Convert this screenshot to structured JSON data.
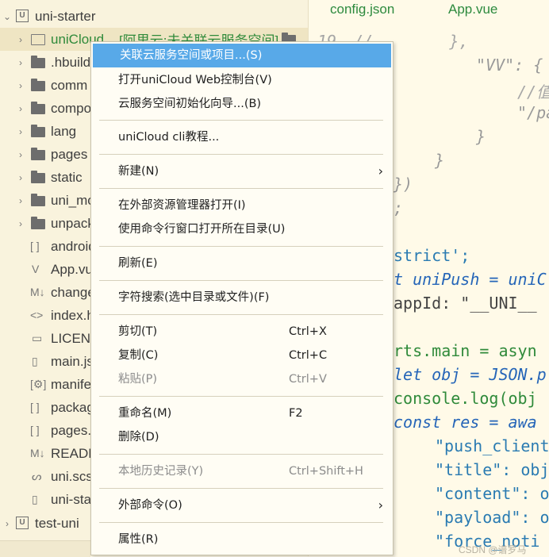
{
  "sidebar": {
    "project_root": "uni-starter",
    "items": [
      {
        "label": "uniCloud",
        "suffix": "[阿里云:未关联云服务空间]",
        "icon": "folder-open-icon"
      },
      {
        "label": ".hbuild",
        "icon": "folder-icon"
      },
      {
        "label": "comm",
        "icon": "folder-icon"
      },
      {
        "label": "compo",
        "icon": "folder-icon"
      },
      {
        "label": "lang",
        "icon": "folder-icon"
      },
      {
        "label": "pages",
        "icon": "folder-icon"
      },
      {
        "label": "static",
        "icon": "folder-icon"
      },
      {
        "label": "uni_mo",
        "icon": "folder-icon"
      },
      {
        "label": "unpack",
        "icon": "folder-icon"
      },
      {
        "label": "android",
        "icon": "json-icon"
      },
      {
        "label": "App.vu",
        "icon": "vue-icon"
      },
      {
        "label": "change",
        "icon": "markdown-icon"
      },
      {
        "label": "index.h",
        "icon": "html-icon"
      },
      {
        "label": "LICENS",
        "icon": "file-icon"
      },
      {
        "label": "main.js",
        "icon": "js-icon"
      },
      {
        "label": "manife",
        "icon": "manifest-icon"
      },
      {
        "label": "packag",
        "icon": "json-icon"
      },
      {
        "label": "pages.j",
        "icon": "json-icon"
      },
      {
        "label": "READM",
        "icon": "markdown-icon"
      },
      {
        "label": "uni.scs",
        "icon": "scss-icon"
      },
      {
        "label": "uni-sta",
        "icon": "file-icon"
      }
    ],
    "second_project": "test-uni"
  },
  "tabs": [
    "config.json",
    "App.vue"
  ],
  "code": {
    "line_number": "19",
    "lines": [
      "//        },",
      "\"VV\": {",
      "//值",
      "\"/pa",
      "}",
      "}",
      "})",
      ";",
      "strict';",
      "t uniPush = uniC",
      "appId: \"__UNI__",
      "rts.main = asyn",
      "let obj = JSON.p",
      "console.log(obj",
      "const res = awa",
      "\"push_client",
      "\"title\": obj",
      "\"content\": o",
      "\"payload\": o",
      "\"force_noti"
    ]
  },
  "context_menu": {
    "items": [
      {
        "label": "关联云服务空间或项目...(S)",
        "highlighted": true
      },
      {
        "label": "打开uniCloud Web控制台(V)"
      },
      {
        "label": "云服务空间初始化向导...(B)"
      },
      {
        "label": "uniCloud cli教程..."
      },
      {
        "label": "新建(N)",
        "submenu": true
      },
      {
        "label": "在外部资源管理器打开(I)"
      },
      {
        "label": "使用命令行窗口打开所在目录(U)"
      },
      {
        "label": "刷新(E)"
      },
      {
        "label": "字符搜索(选中目录或文件)(F)"
      },
      {
        "label": "剪切(T)",
        "shortcut": "Ctrl+X"
      },
      {
        "label": "复制(C)",
        "shortcut": "Ctrl+C"
      },
      {
        "label": "粘贴(P)",
        "shortcut": "Ctrl+V",
        "disabled": true
      },
      {
        "label": "重命名(M)",
        "shortcut": "F2"
      },
      {
        "label": "删除(D)"
      },
      {
        "label": "本地历史记录(Y)",
        "shortcut": "Ctrl+Shift+H",
        "disabled": true
      },
      {
        "label": "外部命令(O)",
        "submenu": true
      },
      {
        "label": "属性(R)"
      }
    ],
    "submenu_arrow": "›"
  },
  "watermark": "CSDN @谱罗马"
}
